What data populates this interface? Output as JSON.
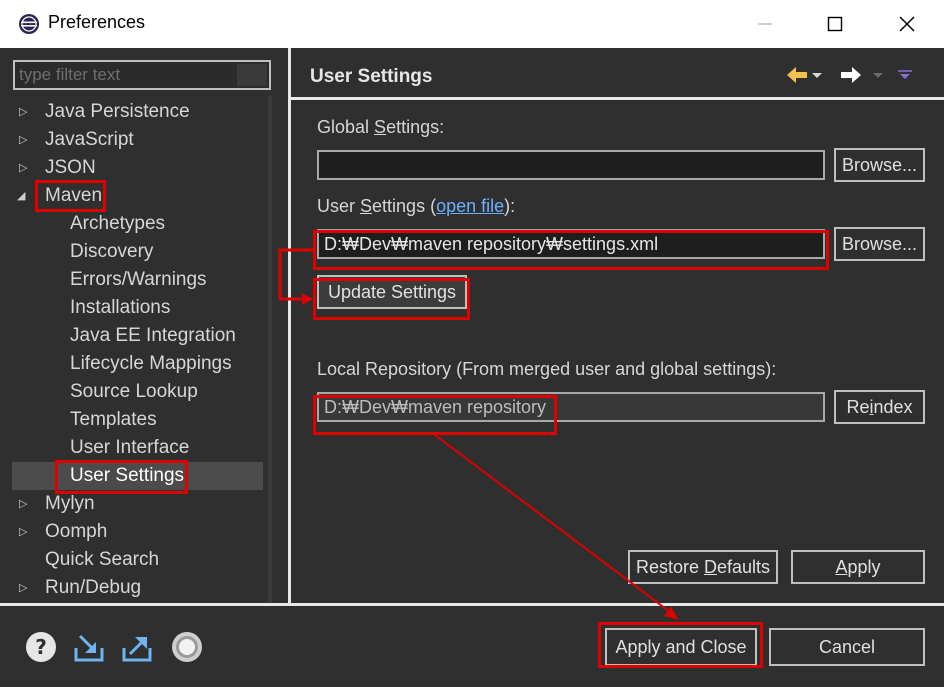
{
  "window": {
    "title": "Preferences"
  },
  "filter": {
    "placeholder": "type filter text"
  },
  "tree": {
    "items": [
      {
        "label": "Java Persistence",
        "expander": "collapsed"
      },
      {
        "label": "JavaScript",
        "expander": "collapsed"
      },
      {
        "label": "JSON",
        "expander": "collapsed"
      },
      {
        "label": "Maven",
        "expander": "expanded"
      },
      {
        "label": "Archetypes"
      },
      {
        "label": "Discovery"
      },
      {
        "label": "Errors/Warnings"
      },
      {
        "label": "Installations"
      },
      {
        "label": "Java EE Integration"
      },
      {
        "label": "Lifecycle Mappings"
      },
      {
        "label": "Source Lookup"
      },
      {
        "label": "Templates"
      },
      {
        "label": "User Interface"
      },
      {
        "label": "User Settings",
        "selected": true
      },
      {
        "label": "Mylyn",
        "expander": "collapsed"
      },
      {
        "label": "Oomph",
        "expander": "collapsed"
      },
      {
        "label": "Quick Search"
      },
      {
        "label": "Run/Debug",
        "expander": "collapsed"
      }
    ]
  },
  "page": {
    "title": "User Settings",
    "global_settings_label_pre": "Global ",
    "global_settings_label_key": "S",
    "global_settings_label_post": "ettings:",
    "global_settings_value": "",
    "browse_label": "Browse...",
    "user_settings_label_pre": "User ",
    "user_settings_label_key": "S",
    "user_settings_label_post": "ettings (",
    "open_file_link": "open file",
    "user_settings_label_end": "):",
    "user_settings_value": "D:₩Dev₩maven repository₩settings.xml",
    "update_settings_label": "Update Settings",
    "local_repo_label": "Local Repository (From merged user and global settings):",
    "local_repo_value": "D:₩Dev₩maven repository",
    "reindex_label_pre": "Re",
    "reindex_label_key": "i",
    "reindex_label_post": "ndex",
    "restore_defaults_pre": "Restore ",
    "restore_defaults_key": "D",
    "restore_defaults_post": "efaults",
    "apply_label_key": "A",
    "apply_label_post": "pply"
  },
  "footer": {
    "apply_close_label": "Apply and Close",
    "cancel_label": "Cancel",
    "icons": [
      "help-icon",
      "import-icon",
      "export-icon",
      "record-icon"
    ]
  },
  "colors": {
    "background": "#2f2f2f",
    "annotation": "#e00000",
    "link": "#6ab0ff",
    "nav_back_arrow": "#f2c14e"
  }
}
